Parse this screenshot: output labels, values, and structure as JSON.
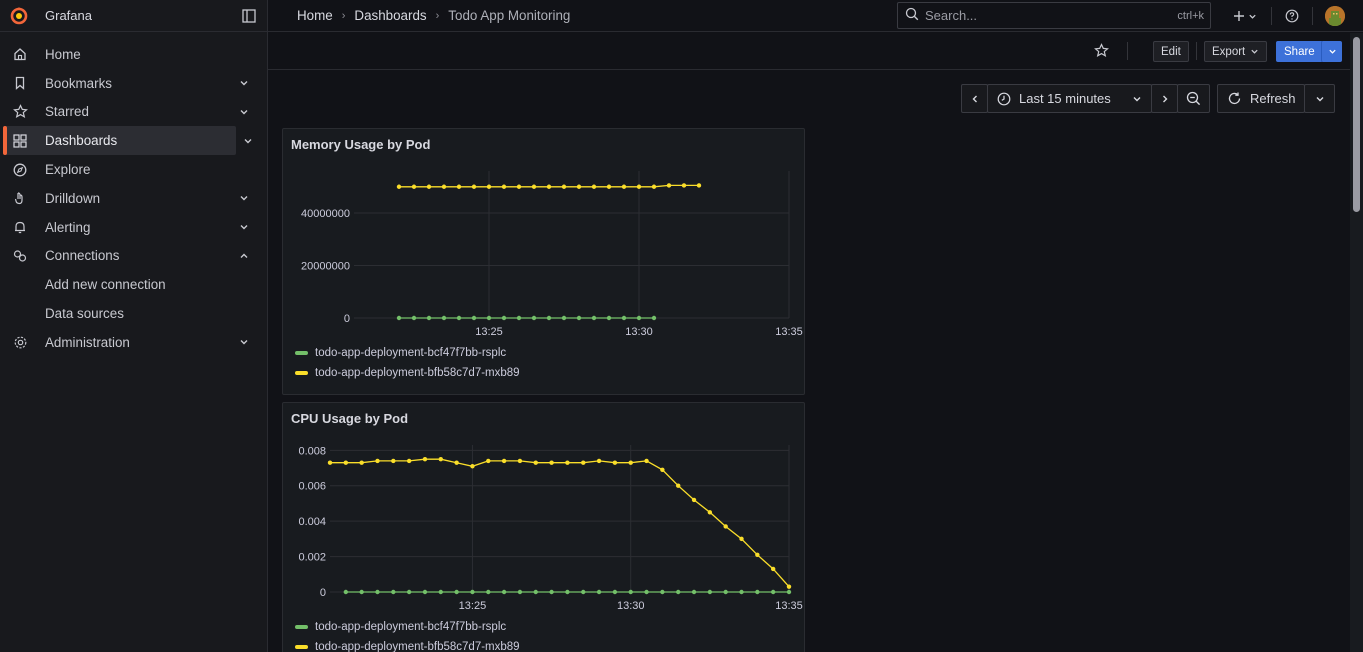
{
  "app": {
    "brand": "Grafana"
  },
  "sidebar": {
    "items": [
      {
        "label": "Home",
        "icon": "home-icon",
        "expand": ""
      },
      {
        "label": "Bookmarks",
        "icon": "bookmark-icon",
        "expand": "down"
      },
      {
        "label": "Starred",
        "icon": "star-icon",
        "expand": "down"
      },
      {
        "label": "Dashboards",
        "icon": "apps-icon",
        "expand": "down",
        "active": true
      },
      {
        "label": "Explore",
        "icon": "compass-icon",
        "expand": ""
      },
      {
        "label": "Drilldown",
        "icon": "drilldown-icon",
        "expand": "down"
      },
      {
        "label": "Alerting",
        "icon": "bell-icon",
        "expand": "down"
      },
      {
        "label": "Connections",
        "icon": "link-icon",
        "expand": "up"
      }
    ],
    "sub_items": [
      "Add new connection",
      "Data sources"
    ],
    "administration": {
      "label": "Administration",
      "icon": "cog-icon"
    }
  },
  "breadcrumb": {
    "home": "Home",
    "dashboards": "Dashboards",
    "current": "Todo App Monitoring"
  },
  "search": {
    "placeholder": "Search...",
    "shortcut": "ctrl+k"
  },
  "toolbar": {
    "edit": "Edit",
    "export": "Export",
    "share": "Share"
  },
  "time": {
    "range": "Last 15 minutes",
    "refresh": "Refresh"
  },
  "colors": {
    "accent": "#f2663a",
    "green": "#73bf69",
    "yellow": "#fade2a",
    "share": "#3d71d9"
  },
  "panels": {
    "memory": {
      "title": "Memory Usage by Pod",
      "legend": [
        "todo-app-deployment-bcf47f7bb-rsplc",
        "todo-app-deployment-bfb58c7d7-mxb89"
      ]
    },
    "cpu": {
      "title": "CPU Usage by Pod",
      "legend": [
        "todo-app-deployment-bcf47f7bb-rsplc",
        "todo-app-deployment-bfb58c7d7-mxb89"
      ]
    }
  },
  "chart_data": [
    {
      "type": "line",
      "title": "Memory Usage by Pod",
      "x_ticks": [
        "13:25",
        "13:30",
        "13:35"
      ],
      "y_ticks": [
        "0",
        "20000000",
        "40000000"
      ],
      "ylim": [
        0,
        56000000
      ],
      "xlim_minutes": [
        20.5,
        35
      ],
      "grid": true,
      "legend_position": "bottom",
      "series": [
        {
          "name": "todo-app-deployment-bcf47f7bb-rsplc",
          "color": "#73bf69",
          "x_minutes": [
            22,
            22.5,
            23,
            23.5,
            24,
            24.5,
            25,
            25.5,
            26,
            26.5,
            27,
            27.5,
            28,
            28.5,
            29,
            29.5,
            30,
            30.5
          ],
          "values": [
            0,
            0,
            0,
            0,
            0,
            0,
            0,
            0,
            0,
            0,
            0,
            0,
            0,
            0,
            0,
            0,
            0,
            0
          ]
        },
        {
          "name": "todo-app-deployment-bfb58c7d7-mxb89",
          "color": "#fade2a",
          "x_minutes": [
            22,
            22.5,
            23,
            23.5,
            24,
            24.5,
            25,
            25.5,
            26,
            26.5,
            27,
            27.5,
            28,
            28.5,
            29,
            29.5,
            30,
            30.5,
            31,
            31.5,
            32
          ],
          "values": [
            50000000,
            50000000,
            50000000,
            50000000,
            50000000,
            50000000,
            50000000,
            50000000,
            50000000,
            50000000,
            50000000,
            50000000,
            50000000,
            50000000,
            50000000,
            50000000,
            50000000,
            50000000,
            50500000,
            50500000,
            50500000
          ]
        }
      ]
    },
    {
      "type": "line",
      "title": "CPU Usage by Pod",
      "x_ticks": [
        "13:25",
        "13:30",
        "13:35"
      ],
      "y_ticks": [
        "0",
        "0.002",
        "0.004",
        "0.006",
        "0.008"
      ],
      "ylim": [
        0,
        0.0083
      ],
      "xlim_minutes": [
        20.5,
        35
      ],
      "grid": true,
      "legend_position": "bottom",
      "series": [
        {
          "name": "todo-app-deployment-bcf47f7bb-rsplc",
          "color": "#73bf69",
          "x_minutes": [
            21,
            21.5,
            22,
            22.5,
            23,
            23.5,
            24,
            24.5,
            25,
            25.5,
            26,
            26.5,
            27,
            27.5,
            28,
            28.5,
            29,
            29.5,
            30,
            30.5,
            31,
            31.5,
            32,
            32.5,
            33,
            33.5,
            34,
            34.5,
            35
          ],
          "values": [
            0,
            0,
            0,
            0,
            0,
            0,
            0,
            0,
            0,
            0,
            0,
            0,
            0,
            0,
            0,
            0,
            0,
            0,
            0,
            0,
            0,
            0,
            0,
            0,
            0,
            0,
            0,
            0,
            0
          ]
        },
        {
          "name": "todo-app-deployment-bfb58c7d7-mxb89",
          "color": "#fade2a",
          "x_minutes": [
            20.5,
            21,
            21.5,
            22,
            22.5,
            23,
            23.5,
            24,
            24.5,
            25,
            25.5,
            26,
            26.5,
            27,
            27.5,
            28,
            28.5,
            29,
            29.5,
            30,
            30.5,
            31,
            31.5,
            32,
            32.5,
            33,
            33.5,
            34,
            34.5,
            35
          ],
          "values": [
            0.0073,
            0.0073,
            0.0073,
            0.0074,
            0.0074,
            0.0074,
            0.0075,
            0.0075,
            0.0073,
            0.0071,
            0.0074,
            0.0074,
            0.0074,
            0.0073,
            0.0073,
            0.0073,
            0.0073,
            0.0074,
            0.0073,
            0.0073,
            0.0074,
            0.0069,
            0.006,
            0.0052,
            0.0045,
            0.0037,
            0.003,
            0.0021,
            0.0013,
            0.0003
          ]
        }
      ]
    }
  ]
}
